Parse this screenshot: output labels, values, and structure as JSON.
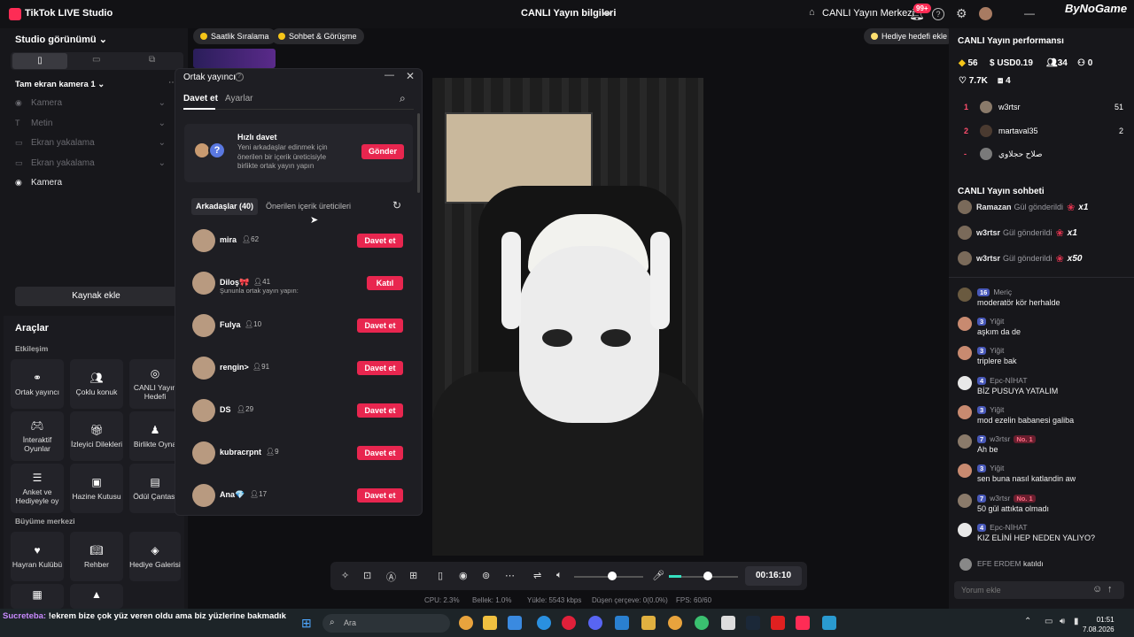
{
  "app": {
    "title": "TikTok LIVE Studio",
    "center_title": "CANLI Yayın bilgileri",
    "live_center": "CANLI Yayın Merkezi",
    "notif_badge": "99+",
    "watermark": "ByNoGame"
  },
  "left": {
    "studio_view": "Studio görünümü",
    "camera_dropdown": "Tam ekran kamera 1",
    "sources": [
      {
        "label": "Kamera",
        "icon": "camera-icon"
      },
      {
        "label": "Metin",
        "icon": "text-icon"
      },
      {
        "label": "Ekran yakalama",
        "icon": "monitor-icon"
      },
      {
        "label": "Ekran yakalama",
        "icon": "monitor-icon"
      },
      {
        "label": "Kamera",
        "icon": "camera-icon"
      }
    ],
    "add_source": "Kaynak ekle",
    "tools_title": "Araçlar",
    "interaction_title": "Etkileşim",
    "tools": [
      "Ortak yayıncı",
      "Çoklu konuk",
      "CANLI Yayın Hedefi",
      "İnteraktif Oyunlar",
      "İzleyici Dilekleri",
      "Birlikte Oyna",
      "Anket ve Hediyeyle oy",
      "Hazine Kutusu",
      "Ödül Çantası"
    ],
    "growth_title": "Büyüme merkezi",
    "growth": [
      "Hayran Kulübü",
      "Rehber",
      "Hediye Galerisi"
    ]
  },
  "top": {
    "pill1": "Saatlik Sıralama",
    "pill2": "Sohbet & Görüşme",
    "gift_goal": "Hediye hedefi ekle"
  },
  "modal": {
    "title": "Ortak yayıncı",
    "tab_invite": "Davet et",
    "tab_settings": "Ayarlar",
    "quick_title": "Hızlı davet",
    "quick_desc": "Yeni arkadaşlar edinmek için önerilen bir içerik üreticisiyle birlikte ortak yayın yapın",
    "send": "Gönder",
    "subtab_friends": "Arkadaşlar (40)",
    "subtab_suggested": "Önerilen içerik üreticileri",
    "friends": [
      {
        "name": "mira",
        "count": "62",
        "button": "Davet et"
      },
      {
        "name": "Diloş🎀",
        "count": "41",
        "button": "Katıl",
        "sub": "Şununla ortak yayın yapın:"
      },
      {
        "name": "Fulya",
        "count": "10",
        "button": "Davet et"
      },
      {
        "name": "rengin>",
        "count": "91",
        "button": "Davet et"
      },
      {
        "name": "DS",
        "count": "29",
        "button": "Davet et"
      },
      {
        "name": "kubracrpnt",
        "count": "9",
        "button": "Davet et"
      },
      {
        "name": "Ana💎",
        "count": "17",
        "button": "Davet et"
      }
    ]
  },
  "right": {
    "perf_title": "CANLI Yayın performansı",
    "diamonds": "56",
    "usd": "USD0.19",
    "viewers": "34",
    "new_followers": "0",
    "likes": "7.7K",
    "gifts": "4",
    "ranking": [
      {
        "rank": "1",
        "name": "w3rtsr",
        "value": "51"
      },
      {
        "rank": "2",
        "name": "martaval35",
        "value": "2"
      },
      {
        "rank": "-",
        "name": "صلاح حجلاوي",
        "value": ""
      }
    ],
    "chat_title": "CANLI Yayın sohbeti",
    "gifts_list": [
      {
        "name": "Ramazan",
        "text": "Gül gönderildi",
        "mult": "x1"
      },
      {
        "name": "w3rtsr",
        "text": "Gül gönderildi",
        "mult": "x1"
      },
      {
        "name": "w3rtsr",
        "text": "Gül gönderildi",
        "mult": "x50"
      }
    ],
    "messages": [
      {
        "level": "16",
        "name": "Meriç",
        "text": "moderatör kör herhalde",
        "no1": ""
      },
      {
        "level": "3",
        "name": "Yiğit",
        "text": "aşkım da de",
        "no1": ""
      },
      {
        "level": "3",
        "name": "Yiğit",
        "text": "triplere bak",
        "no1": ""
      },
      {
        "level": "4",
        "name": "Epc-NİHAT",
        "text": "BİZ PUSUYA YATALIM",
        "no1": ""
      },
      {
        "level": "3",
        "name": "Yiğit",
        "text": "mod ezelin babanesi galiba",
        "no1": ""
      },
      {
        "level": "7",
        "name": "w3rtsr",
        "text": "Ah be",
        "no1": "No. 1"
      },
      {
        "level": "3",
        "name": "Yiğit",
        "text": "sen buna nasıl katlandin aw",
        "no1": ""
      },
      {
        "level": "7",
        "name": "w3rtsr",
        "text": "50 gül attıkta olmadı",
        "no1": "No. 1"
      },
      {
        "level": "4",
        "name": "Epc-NİHAT",
        "text": "KIZ ELİNİ HEP NEDEN YALIYO?",
        "no1": ""
      }
    ],
    "joined_name": "EFE ERDEM",
    "joined_text": "katıldı",
    "comment_placeholder": "Yorum ekle"
  },
  "bottom": {
    "timer": "00:16:10",
    "cpu": "CPU: 2.3%",
    "memory": "Bellek: 1.0%",
    "upload": "Yükle: 5543 kbps",
    "dropped": "Düşen çerçeve: 0(0.0%)",
    "fps": "FPS: 60/60"
  },
  "taskbar": {
    "ticker_name": "Sucreteba:",
    "ticker_text": "!ekrem bize çok yüz veren oldu ama biz yüzlerine bakmadık",
    "search": "Ara",
    "time": "01:51",
    "date": "7.08.2026"
  }
}
